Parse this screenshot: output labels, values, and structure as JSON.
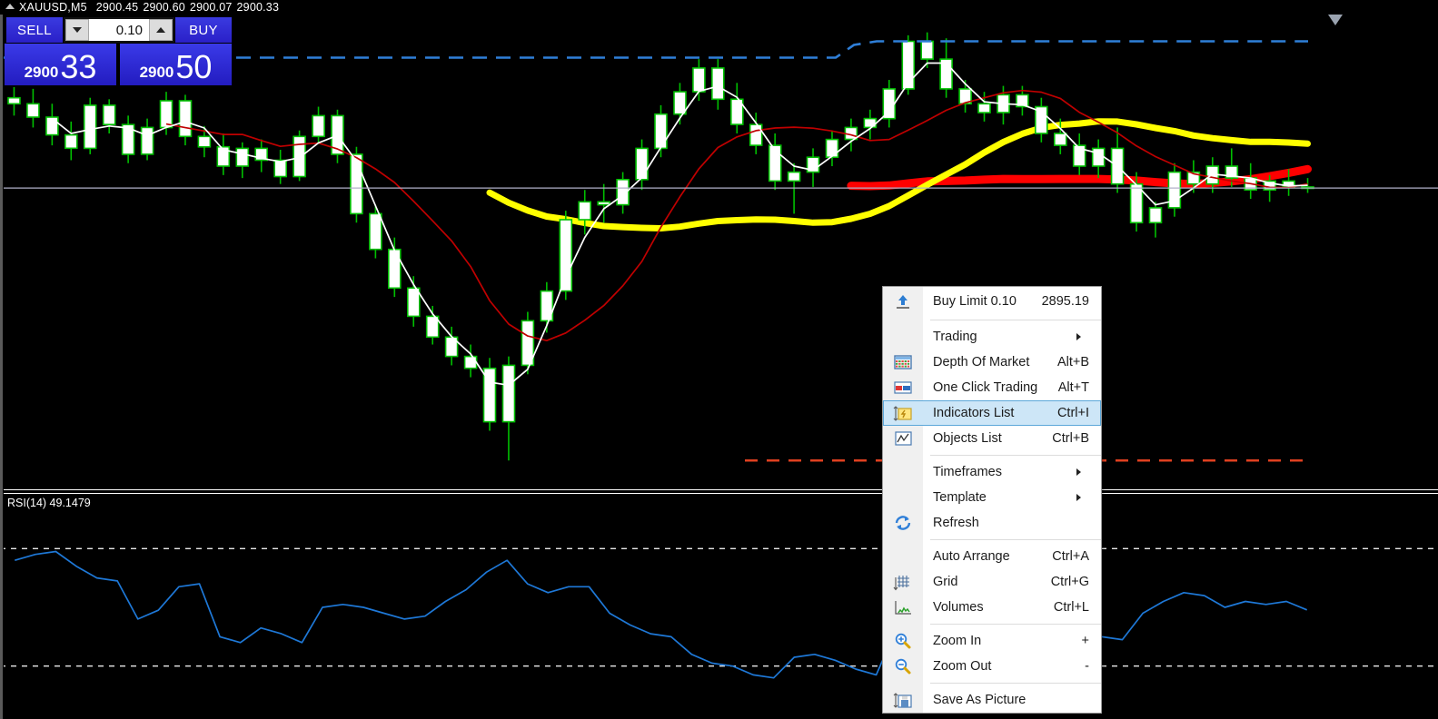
{
  "window": {
    "symbol_timeframe": "XAUUSD,M5",
    "ohlc": [
      "2900.45",
      "2900.60",
      "2900.07",
      "2900.33"
    ],
    "collapse_icon": "triangle-up-icon"
  },
  "one_click_trading": {
    "sell_label": "SELL",
    "buy_label": "BUY",
    "volume": "0.10",
    "decrease_icon": "triangle-down-icon",
    "increase_icon": "triangle-up-icon",
    "sell_price_big": "33",
    "sell_price_small": "2900",
    "buy_price_big": "50",
    "buy_price_small": "2900"
  },
  "indicator_subwindow": {
    "label": "RSI(14) 49.1479",
    "name": "RSI",
    "period": 14,
    "value": "49.1479",
    "levels": [
      70,
      30
    ],
    "line_color": "#1e78d7"
  },
  "context_menu": {
    "items": [
      {
        "label": "Buy Limit 0.10",
        "accel": "2895.19",
        "icon": "arrow-up-blue-icon",
        "type": "item",
        "selected": false
      },
      {
        "type": "separator"
      },
      {
        "label": "Trading",
        "accel": "",
        "icon": "",
        "type": "submenu",
        "selected": false
      },
      {
        "label": "Depth Of Market",
        "accel": "Alt+B",
        "icon": "depth-of-market-icon",
        "type": "item",
        "selected": false
      },
      {
        "label": "One Click Trading",
        "accel": "Alt+T",
        "icon": "one-click-trading-icon",
        "type": "item",
        "selected": false
      },
      {
        "label": "Indicators List",
        "accel": "Ctrl+I",
        "icon": "indicators-list-icon",
        "type": "item",
        "selected": true
      },
      {
        "label": "Objects List",
        "accel": "Ctrl+B",
        "icon": "objects-list-icon",
        "type": "item",
        "selected": false
      },
      {
        "type": "separator"
      },
      {
        "label": "Timeframes",
        "accel": "",
        "icon": "",
        "type": "submenu",
        "selected": false
      },
      {
        "label": "Template",
        "accel": "",
        "icon": "",
        "type": "submenu",
        "selected": false
      },
      {
        "label": "Refresh",
        "accel": "",
        "icon": "refresh-icon",
        "type": "item",
        "selected": false
      },
      {
        "type": "separator"
      },
      {
        "label": "Auto Arrange",
        "accel": "Ctrl+A",
        "icon": "",
        "type": "item",
        "selected": false
      },
      {
        "label": "Grid",
        "accel": "Ctrl+G",
        "icon": "grid-icon",
        "type": "item",
        "selected": false
      },
      {
        "label": "Volumes",
        "accel": "Ctrl+L",
        "icon": "volumes-icon",
        "type": "item",
        "selected": false
      },
      {
        "type": "separator"
      },
      {
        "label": "Zoom In",
        "accel": "+",
        "icon": "zoom-in-icon",
        "type": "item",
        "selected": false
      },
      {
        "label": "Zoom Out",
        "accel": "-",
        "icon": "zoom-out-icon",
        "type": "item",
        "selected": false
      },
      {
        "type": "separator"
      },
      {
        "label": "Save As Picture",
        "accel": "",
        "icon": "save-as-picture-icon",
        "type": "item",
        "selected": false
      }
    ]
  },
  "colors": {
    "background": "#000000",
    "candle_outline": "#00c000",
    "candle_body": "#ffffff",
    "ma_yellow": "#ffff00",
    "ma_red_thick": "#ff0000",
    "ma_red_thin": "#c00000",
    "ma_white_thin": "#ffffff",
    "level_blue_dashed": "#2f7fd8",
    "level_red_dashed": "#e04020",
    "bid_line": "#b0b0c8",
    "menu_highlight": "#cde6f7",
    "trade_panel": "#2a20c8"
  },
  "chart_data": {
    "type": "candlestick",
    "title": "XAUUSD,M5",
    "symbol": "XAUUSD",
    "timeframe": "M5",
    "ohlc_header": {
      "open": 2900.45,
      "high": 2900.6,
      "low": 2900.07,
      "close": 2900.33
    },
    "bid_price": 2900.33,
    "ask_price": 2900.5,
    "pending_order": {
      "type": "Buy Limit",
      "volume": 0.1,
      "price": 2895.19
    },
    "ylim": [
      2880.0,
      2912.0
    ],
    "grid": false,
    "horizontal_levels": [
      {
        "value": 2910.2,
        "color": "#2f7fd8",
        "style": "dashed",
        "label": ""
      },
      {
        "value": 2900.33,
        "color": "#b0b0c8",
        "style": "solid",
        "label": "bid"
      },
      {
        "value": 2882.0,
        "color": "#e04020",
        "style": "dashed",
        "label": ""
      }
    ],
    "overlays": [
      {
        "name": "MA slow",
        "color": "#ffff00",
        "width": 7
      },
      {
        "name": "MA slowest",
        "color": "#ff0000",
        "width": 9
      },
      {
        "name": "MA medium",
        "color": "#c00000",
        "width": 1.6
      },
      {
        "name": "MA fast",
        "color": "#ffffff",
        "width": 1.6
      }
    ],
    "candles": [
      {
        "o": 2906.4,
        "h": 2907.6,
        "l": 2905.2,
        "c": 2906.0
      },
      {
        "o": 2906.0,
        "h": 2907.0,
        "l": 2904.4,
        "c": 2905.1
      },
      {
        "o": 2905.1,
        "h": 2906.0,
        "l": 2903.2,
        "c": 2903.9
      },
      {
        "o": 2903.9,
        "h": 2904.8,
        "l": 2902.2,
        "c": 2903.0
      },
      {
        "o": 2903.0,
        "h": 2906.4,
        "l": 2902.6,
        "c": 2905.9
      },
      {
        "o": 2905.9,
        "h": 2906.3,
        "l": 2904.0,
        "c": 2904.6
      },
      {
        "o": 2904.6,
        "h": 2905.2,
        "l": 2902.0,
        "c": 2902.6
      },
      {
        "o": 2902.6,
        "h": 2905.0,
        "l": 2902.2,
        "c": 2904.4
      },
      {
        "o": 2904.4,
        "h": 2906.8,
        "l": 2903.9,
        "c": 2906.2
      },
      {
        "o": 2906.2,
        "h": 2906.6,
        "l": 2903.2,
        "c": 2903.8
      },
      {
        "o": 2903.8,
        "h": 2904.5,
        "l": 2902.4,
        "c": 2903.1
      },
      {
        "o": 2903.1,
        "h": 2904.0,
        "l": 2901.2,
        "c": 2901.8
      },
      {
        "o": 2901.8,
        "h": 2903.4,
        "l": 2901.0,
        "c": 2903.0
      },
      {
        "o": 2903.0,
        "h": 2903.6,
        "l": 2901.4,
        "c": 2902.2
      },
      {
        "o": 2902.2,
        "h": 2902.9,
        "l": 2900.6,
        "c": 2901.1
      },
      {
        "o": 2901.1,
        "h": 2904.2,
        "l": 2900.8,
        "c": 2903.8
      },
      {
        "o": 2903.8,
        "h": 2905.8,
        "l": 2903.3,
        "c": 2905.2
      },
      {
        "o": 2905.2,
        "h": 2905.6,
        "l": 2902.0,
        "c": 2902.6
      },
      {
        "o": 2902.6,
        "h": 2903.1,
        "l": 2898.0,
        "c": 2898.6
      },
      {
        "o": 2898.6,
        "h": 2899.2,
        "l": 2895.6,
        "c": 2896.2
      },
      {
        "o": 2896.2,
        "h": 2897.0,
        "l": 2893.0,
        "c": 2893.6
      },
      {
        "o": 2893.6,
        "h": 2894.4,
        "l": 2891.0,
        "c": 2891.7
      },
      {
        "o": 2891.7,
        "h": 2892.4,
        "l": 2889.8,
        "c": 2890.3
      },
      {
        "o": 2890.3,
        "h": 2891.0,
        "l": 2888.4,
        "c": 2889.0
      },
      {
        "o": 2889.0,
        "h": 2889.8,
        "l": 2887.6,
        "c": 2888.2
      },
      {
        "o": 2888.2,
        "h": 2888.9,
        "l": 2884.0,
        "c": 2884.6
      },
      {
        "o": 2884.6,
        "h": 2889.0,
        "l": 2882.0,
        "c": 2888.4
      },
      {
        "o": 2888.4,
        "h": 2892.0,
        "l": 2887.8,
        "c": 2891.4
      },
      {
        "o": 2891.4,
        "h": 2894.0,
        "l": 2890.6,
        "c": 2893.4
      },
      {
        "o": 2893.4,
        "h": 2898.8,
        "l": 2892.8,
        "c": 2898.2
      },
      {
        "o": 2898.2,
        "h": 2900.2,
        "l": 2897.2,
        "c": 2899.4
      },
      {
        "o": 2899.4,
        "h": 2900.6,
        "l": 2898.0,
        "c": 2899.2
      },
      {
        "o": 2899.2,
        "h": 2901.4,
        "l": 2898.6,
        "c": 2900.9
      },
      {
        "o": 2900.9,
        "h": 2903.6,
        "l": 2900.2,
        "c": 2903.0
      },
      {
        "o": 2903.0,
        "h": 2905.9,
        "l": 2902.4,
        "c": 2905.3
      },
      {
        "o": 2905.3,
        "h": 2907.4,
        "l": 2904.6,
        "c": 2906.8
      },
      {
        "o": 2906.8,
        "h": 2909.0,
        "l": 2906.2,
        "c": 2908.4
      },
      {
        "o": 2908.4,
        "h": 2909.0,
        "l": 2905.6,
        "c": 2906.3
      },
      {
        "o": 2906.3,
        "h": 2907.4,
        "l": 2904.0,
        "c": 2904.6
      },
      {
        "o": 2904.6,
        "h": 2905.4,
        "l": 2902.6,
        "c": 2903.2
      },
      {
        "o": 2903.2,
        "h": 2904.0,
        "l": 2900.2,
        "c": 2900.8
      },
      {
        "o": 2900.8,
        "h": 2902.0,
        "l": 2898.6,
        "c": 2901.4
      },
      {
        "o": 2901.4,
        "h": 2903.0,
        "l": 2900.4,
        "c": 2902.4
      },
      {
        "o": 2902.4,
        "h": 2904.2,
        "l": 2901.8,
        "c": 2903.6
      },
      {
        "o": 2903.6,
        "h": 2905.0,
        "l": 2902.8,
        "c": 2904.4
      },
      {
        "o": 2904.4,
        "h": 2905.6,
        "l": 2903.6,
        "c": 2905.0
      },
      {
        "o": 2905.0,
        "h": 2907.6,
        "l": 2904.4,
        "c": 2907.0
      },
      {
        "o": 2907.0,
        "h": 2910.6,
        "l": 2906.6,
        "c": 2910.2
      },
      {
        "o": 2910.2,
        "h": 2910.8,
        "l": 2908.4,
        "c": 2909.0
      },
      {
        "o": 2909.0,
        "h": 2910.4,
        "l": 2906.4,
        "c": 2907.0
      },
      {
        "o": 2907.0,
        "h": 2907.6,
        "l": 2905.4,
        "c": 2906.0
      },
      {
        "o": 2906.0,
        "h": 2906.8,
        "l": 2904.8,
        "c": 2905.4
      },
      {
        "o": 2905.4,
        "h": 2907.2,
        "l": 2904.6,
        "c": 2906.6
      },
      {
        "o": 2906.6,
        "h": 2907.2,
        "l": 2905.2,
        "c": 2905.8
      },
      {
        "o": 2905.8,
        "h": 2906.4,
        "l": 2903.4,
        "c": 2904.0
      },
      {
        "o": 2904.0,
        "h": 2905.0,
        "l": 2902.6,
        "c": 2903.2
      },
      {
        "o": 2903.2,
        "h": 2904.0,
        "l": 2901.2,
        "c": 2901.8
      },
      {
        "o": 2901.8,
        "h": 2903.6,
        "l": 2901.0,
        "c": 2903.0
      },
      {
        "o": 2903.0,
        "h": 2904.4,
        "l": 2900.0,
        "c": 2900.6
      },
      {
        "o": 2900.6,
        "h": 2901.4,
        "l": 2897.4,
        "c": 2898.0
      },
      {
        "o": 2898.0,
        "h": 2899.4,
        "l": 2897.0,
        "c": 2899.0
      },
      {
        "o": 2899.0,
        "h": 2902.0,
        "l": 2898.4,
        "c": 2901.4
      },
      {
        "o": 2901.4,
        "h": 2902.2,
        "l": 2900.0,
        "c": 2900.6
      },
      {
        "o": 2900.6,
        "h": 2902.4,
        "l": 2900.0,
        "c": 2901.8
      },
      {
        "o": 2901.8,
        "h": 2903.0,
        "l": 2900.4,
        "c": 2901.0
      },
      {
        "o": 2901.0,
        "h": 2902.0,
        "l": 2899.6,
        "c": 2900.2
      },
      {
        "o": 2900.2,
        "h": 2901.2,
        "l": 2899.4,
        "c": 2900.8
      },
      {
        "o": 2900.8,
        "h": 2901.6,
        "l": 2899.8,
        "c": 2900.4
      },
      {
        "o": 2900.4,
        "h": 2901.0,
        "l": 2900.0,
        "c": 2900.33
      }
    ],
    "rsi_series": [
      66,
      68,
      69,
      64,
      60,
      59,
      46,
      49,
      57,
      58,
      40,
      38,
      43,
      41,
      38,
      50,
      51,
      50,
      48,
      46,
      47,
      52,
      56,
      62,
      66,
      58,
      55,
      57,
      57,
      48,
      44,
      41,
      40,
      34,
      31,
      30,
      27,
      26,
      33,
      34,
      32,
      29,
      27,
      43,
      46,
      48,
      55,
      57,
      56,
      55,
      56,
      46,
      47,
      40,
      39,
      48,
      52,
      55,
      54,
      50,
      52,
      51,
      52,
      49.15
    ]
  }
}
